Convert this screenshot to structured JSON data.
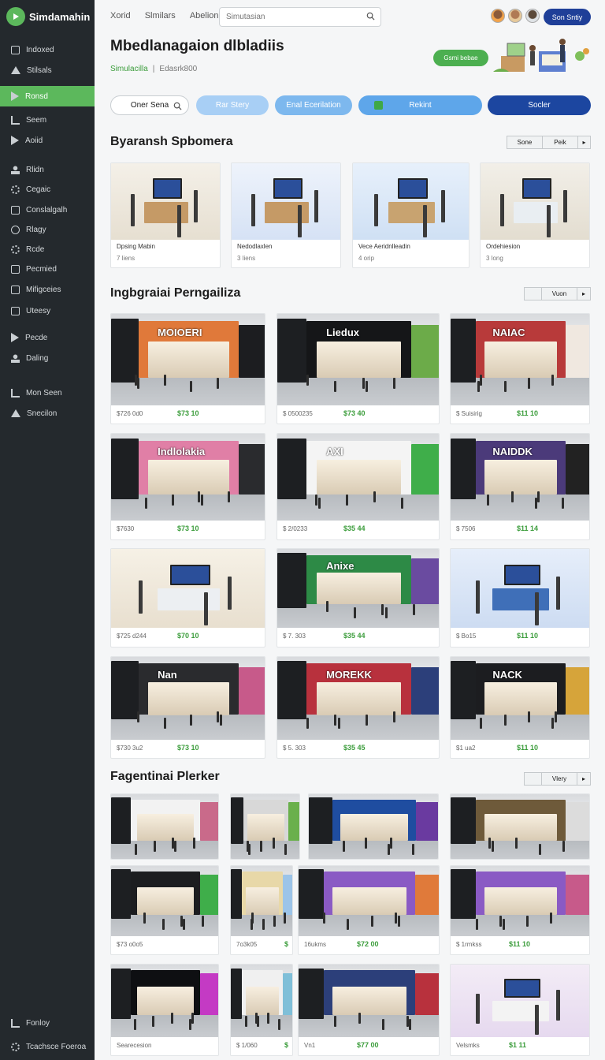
{
  "sidebar": {
    "brand": "Simdamahin",
    "items": [
      {
        "label": "Indoxed",
        "icon": "inbox-icon"
      },
      {
        "label": "Stilsals",
        "icon": "home-icon"
      },
      {
        "label": "Ronsd",
        "icon": "bird-icon",
        "active": true
      },
      {
        "label": "Seem",
        "icon": "bar-icon"
      },
      {
        "label": "Aoiid",
        "icon": "play-icon"
      },
      {
        "label": "Rlidn",
        "icon": "person-icon"
      },
      {
        "label": "Cegaic",
        "icon": "gear-icon"
      },
      {
        "label": "Conslalgalh",
        "icon": "box-icon"
      },
      {
        "label": "Rlagy",
        "icon": "circle-icon"
      },
      {
        "label": "Rcde",
        "icon": "gear-icon"
      },
      {
        "label": "Pecmied",
        "icon": "box-icon"
      },
      {
        "label": "Mifigceies",
        "icon": "grid-icon"
      },
      {
        "label": "Uteesy",
        "icon": "box-icon"
      },
      {
        "label": "Pecde",
        "icon": "play-icon"
      },
      {
        "label": "Daling",
        "icon": "person-icon"
      },
      {
        "label": "Mon Seen",
        "icon": "bar-icon"
      },
      {
        "label": "Snecilon",
        "icon": "home-icon"
      }
    ],
    "footer": [
      {
        "label": "Fonloy",
        "icon": "flag-icon"
      },
      {
        "label": "Tcachsce Foeroa",
        "icon": "gear-icon"
      }
    ]
  },
  "topbar": {
    "links": [
      "Xorid",
      "Slmilars",
      "Abelion"
    ],
    "search_placeholder": "Simutasian",
    "cta": "Son Sntiy"
  },
  "header": {
    "title": "Mbedlanagaion dlbladiis",
    "crumb_active": "Simulacilla",
    "crumb_sep": "|",
    "crumb_rest": "Edasrk800",
    "hero_button": "Gsmi bebae"
  },
  "filters": {
    "search_label": "Oner Sena",
    "b1": "Rar Stery",
    "b2": "Enal Ecerilation",
    "b3": "Rekint",
    "b4": "Socler"
  },
  "section1": {
    "title": "Byaransh Spbomera",
    "ctrl": [
      "Sone",
      "Peik",
      "▸"
    ],
    "cards": [
      {
        "title": "Dpsing Mabin",
        "sub": "7 liens"
      },
      {
        "title": "Nedodlaxlen",
        "sub": "3 liens"
      },
      {
        "title": "Vece Aeridnlleadin",
        "sub": "4 orip"
      },
      {
        "title": "Ordehiesion",
        "sub": "3 long"
      }
    ]
  },
  "section2": {
    "title": "Ingbgraiai Perngailiza",
    "ctrl": [
      "",
      "Vuon",
      "▸"
    ],
    "cards": [
      {
        "code": "$726 0d0",
        "price": "$73 10",
        "sign": "MOIOERI"
      },
      {
        "code": "$ 0500235",
        "price": "$73 40",
        "sign": "Liedux"
      },
      {
        "code": "$ Suisirig",
        "price": "$11 10",
        "sign": "NAIAC"
      },
      {
        "code": "$7630",
        "price": "$73 10",
        "sign": "Indlolakia"
      },
      {
        "code": "$ 2/0233",
        "price": "$35 44",
        "sign": "AXI"
      },
      {
        "code": "$ 7506",
        "price": "$11 14",
        "sign": "NAIDDK"
      },
      {
        "code": "$725 d244",
        "price": "$70 10",
        "sign": ""
      },
      {
        "code": "$ 7. 303",
        "price": "$35 44",
        "sign": "Anixe"
      },
      {
        "code": "$ Bo15",
        "price": "$11 10",
        "sign": ""
      },
      {
        "code": "$730 3u2",
        "price": "$73 10",
        "sign": "Nan"
      },
      {
        "code": "$ 5. 303",
        "price": "$35 45",
        "sign": "MOREKK"
      },
      {
        "code": "$1 ua2",
        "price": "$11 10",
        "sign": "NACK"
      }
    ]
  },
  "section3": {
    "title": "Fagentinai Plerker",
    "ctrl": [
      "",
      "Vlery",
      "▸"
    ],
    "row2": [
      {
        "code": "$73 o0o5",
        "price": ""
      },
      {
        "code": "7o3k05",
        "price": "$"
      },
      {
        "code": "16ukms",
        "price": "$72 00"
      },
      {
        "code": "$ 1rmkss",
        "price": "$11 10"
      }
    ],
    "row3": [
      {
        "code": "Searecesion",
        "price": ""
      },
      {
        "code": "$ 1/060",
        "price": "$"
      },
      {
        "code": "Vn1",
        "price": "$77 00"
      },
      {
        "code": "Velsmks",
        "price": "$1 11"
      }
    ]
  }
}
